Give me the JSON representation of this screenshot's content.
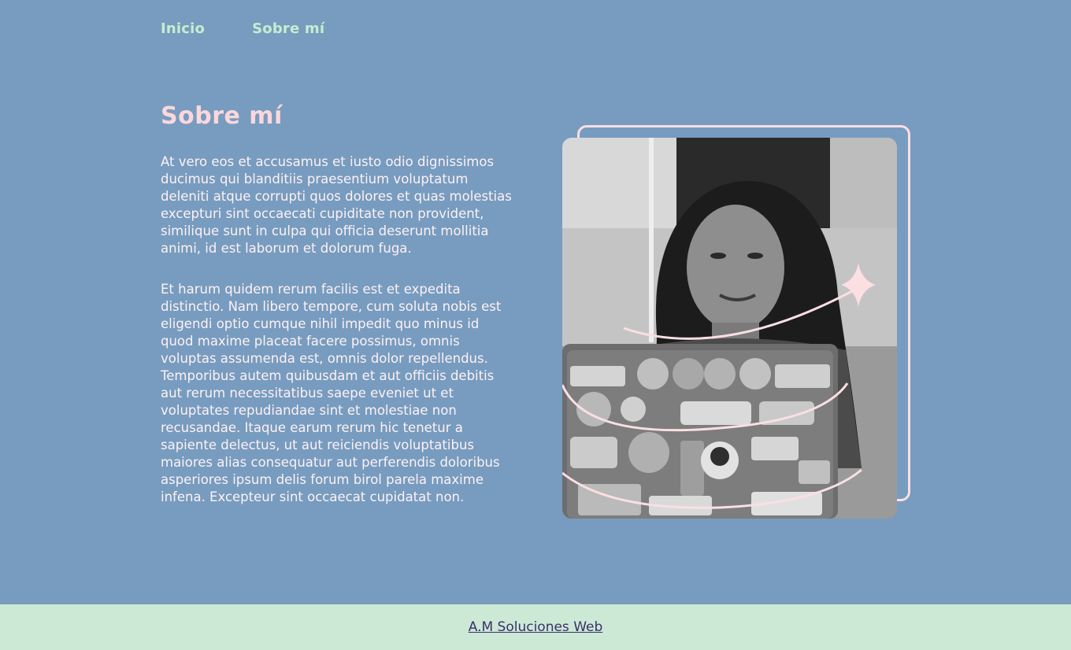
{
  "nav": {
    "items": [
      {
        "label": "Inicio"
      },
      {
        "label": "Sobre mí"
      }
    ]
  },
  "main": {
    "title": "Sobre mí",
    "paragraphs": [
      "At vero eos et accusamus et iusto odio dignissimos ducimus qui blanditiis praesentium voluptatum deleniti atque corrupti quos dolores et quas molestias excepturi sint occaecati cupiditate non provident, similique sunt in culpa qui officia deserunt mollitia animi, id est laborum et dolorum fuga.",
      "Et harum quidem rerum facilis est et expedita distinctio. Nam libero tempore, cum soluta nobis est eligendi optio cumque nihil impedit quo minus id quod maxime placeat facere possimus, omnis voluptas assumenda est, omnis dolor repellendus. Temporibus autem quibusdam et aut officiis debitis aut rerum necessitatibus saepe eveniet ut et voluptates repudiandae sint et molestiae non recusandae. Itaque earum rerum hic tenetur a sapiente delectus, ut aut reiciendis voluptatibus maiores alias consequatur aut perferendis doloribus asperiores ipsum delis forum birol parela maxime infena. Excepteur sint occaecat cupidatat non."
    ]
  },
  "footer": {
    "link_label": "A.M Soluciones Web"
  },
  "colors": {
    "background": "#779cbf",
    "nav_text": "#c8eccf",
    "title": "#fbd7dc",
    "footer_bg": "#cce9d6",
    "footer_link": "#3b2f6b",
    "accent_pink": "#fbdfe3"
  },
  "icons": {
    "sparkle": "sparkle-star-icon"
  }
}
